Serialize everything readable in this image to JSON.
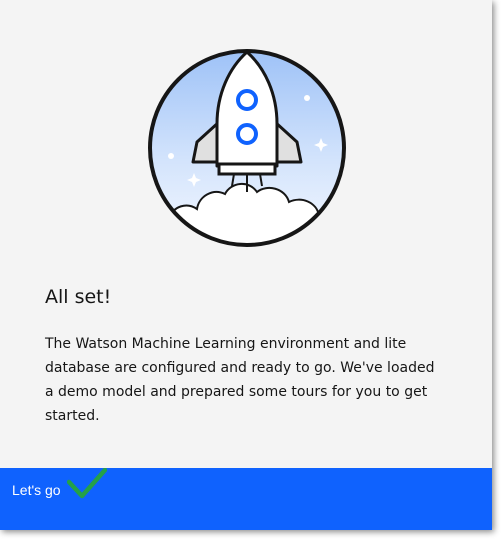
{
  "dialog": {
    "title": "All set!",
    "body": "The Watson Machine Learning environment and lite database are configured and ready to go. We've loaded a demo model and prepared some tours for you to get started.",
    "illustration_icon": "rocket-launch-illustration",
    "primary_button": {
      "label": "Let's go",
      "icon": "checkmark-icon"
    }
  },
  "colors": {
    "primary": "#0f62fe",
    "background": "#f4f4f4",
    "text": "#161616",
    "check": "#24a148"
  }
}
